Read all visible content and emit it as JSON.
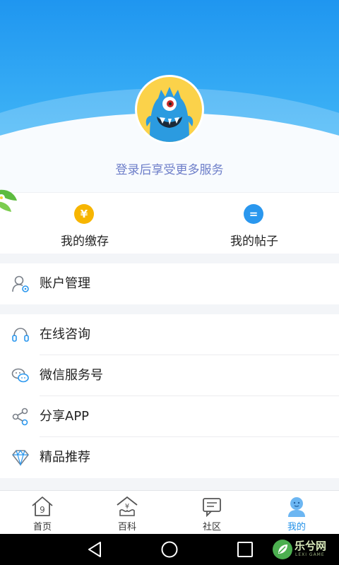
{
  "profile": {
    "login_prompt": "登录后享受更多服务"
  },
  "quick_actions": [
    {
      "label": "我的缴存",
      "icon": "yen-coin-icon",
      "icon_glyph": "¥",
      "color": "#f7b500"
    },
    {
      "label": "我的帖子",
      "icon": "post-bubble-icon",
      "icon_glyph": "=",
      "color": "#2a97ee"
    }
  ],
  "menu": {
    "account": {
      "label": "账户管理",
      "icon": "user-settings-icon"
    },
    "consult": {
      "label": "在线咨询",
      "icon": "headset-icon"
    },
    "wechat": {
      "label": "微信服务号",
      "icon": "wechat-icon"
    },
    "share": {
      "label": "分享APP",
      "icon": "share-icon"
    },
    "recommend": {
      "label": "精品推荐",
      "icon": "diamond-icon"
    }
  },
  "tabs": [
    {
      "label": "首页",
      "icon": "home-icon"
    },
    {
      "label": "百科",
      "icon": "encyclopedia-icon"
    },
    {
      "label": "社区",
      "icon": "community-icon"
    },
    {
      "label": "我的",
      "icon": "profile-icon",
      "active": true
    }
  ],
  "watermark": {
    "text": "乐兮网",
    "sub": "LEXI GAME"
  },
  "colors": {
    "accent": "#1f8fe8",
    "header_top": "#1f96f0",
    "login_text": "#6d7ec9",
    "coin": "#f7b500",
    "post": "#2a97ee"
  }
}
